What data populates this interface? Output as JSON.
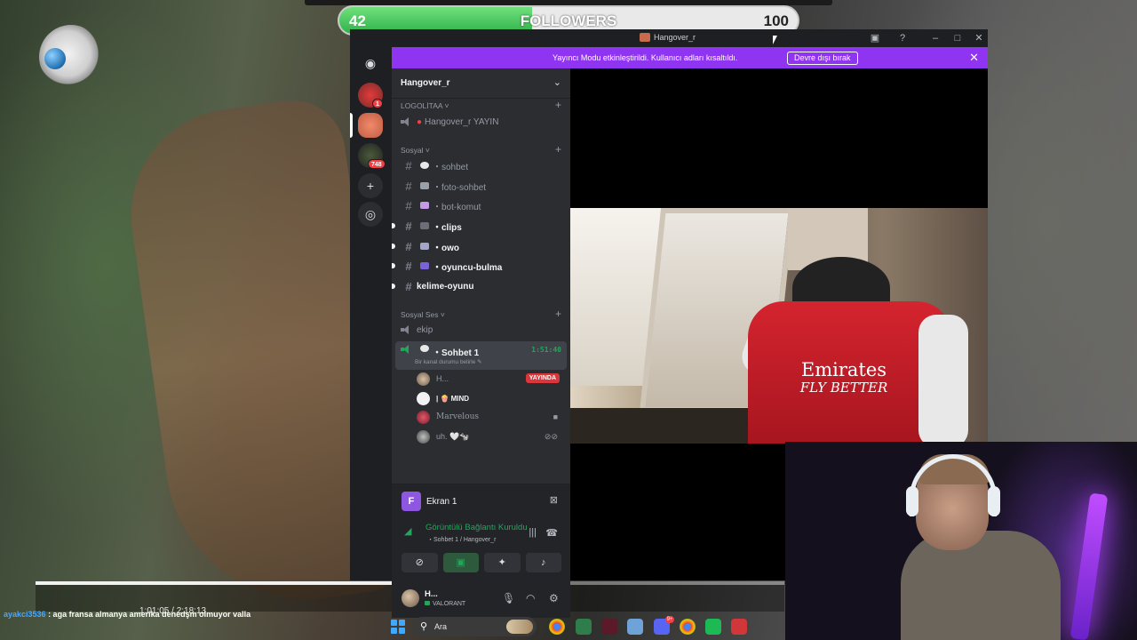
{
  "goal": {
    "current": "42",
    "label": "FOLLOWERS",
    "target": "100",
    "progress": 0.42
  },
  "player": {
    "time": "1:01:05  /  2:18:13",
    "progress": 0.62
  },
  "chat": {
    "user": "ayakci3536",
    "message": " : aga fransa almanya amerika denedşm olmuyor valla"
  },
  "window": {
    "title": "Hangover_r"
  },
  "banner": {
    "message": "Yayıncı Modu etkinleştirildi. Kullanıcı adları kısaltıldı.",
    "button": "Devre dışı bırak"
  },
  "server": {
    "name": "Hangover_r",
    "badges": [
      "1",
      "748"
    ]
  },
  "categories": {
    "logolitaa": "LOGOLİTAA ˅",
    "sosyal": "Sosyal ˅",
    "sosyal_ses": "Sosyal Ses ˅"
  },
  "channels": {
    "yayin": "Hangover_r YAYIN",
    "sohbet": "・sohbet",
    "foto": "・foto-sohbet",
    "bot": "・bot-komut",
    "clips": "・clips",
    "owo": "・owo",
    "oyuncu": "・oyuncu-bulma",
    "kelime": "kelime-oyunu",
    "ekip": "ekip",
    "sohbet1": "・Sohbet 1",
    "sohbet1_timer": "1:51:40",
    "sohbet1_status": "Bir kanal durumu belirle ✎"
  },
  "voice_users": [
    {
      "name": "H...",
      "tag": "YAYINDA"
    },
    {
      "name": "| 🍿 MIND"
    },
    {
      "name": "Marvelous"
    },
    {
      "name": "uh. 🤍🐄"
    }
  ],
  "screen_share": {
    "name": "Ekran 1",
    "avatar_letter": "F"
  },
  "rtc": {
    "title": "Görüntülü Bağlantı Kuruldu",
    "subtitle": "・Sohbet 1 / Hangover_r"
  },
  "user": {
    "name": "H...",
    "activity": "VALORANT"
  },
  "stream": {
    "jersey_line1": "Emirates",
    "jersey_line2": "FLY BETTER"
  },
  "taskbar": {
    "search_placeholder": "Ara",
    "discord_badge": "9+"
  },
  "colors": {
    "discord_bg": "#1e1f22",
    "sidebar_bg": "#2b2d31",
    "banner": "#8f34f1",
    "green": "#23a55a",
    "live_red": "#da373c",
    "goal_fill": "#2fb14a"
  }
}
